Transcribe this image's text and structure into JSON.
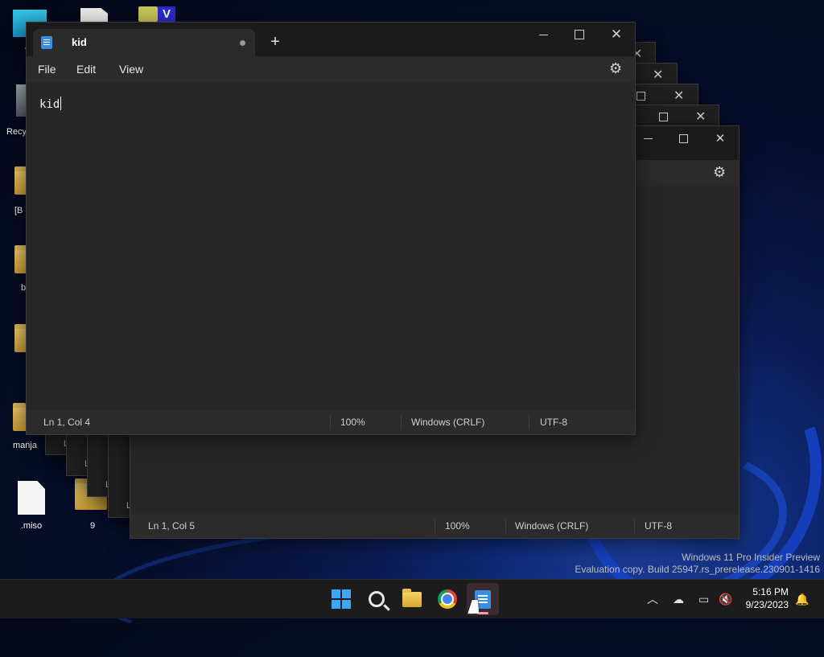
{
  "desktop": {
    "icons": [
      {
        "label": "Th"
      },
      {
        "label": "Recy"
      },
      {
        "label": "[B"
      },
      {
        "label": "b"
      },
      {
        "label": "manja"
      },
      {
        "label": ".miso"
      },
      {
        "label": "9"
      }
    ]
  },
  "main_window": {
    "tab_title": "kid",
    "menu": [
      "File",
      "Edit",
      "View"
    ],
    "content": "kid",
    "status": {
      "position": "Ln 1, Col 4",
      "zoom": "100%",
      "line_ending": "Windows (CRLF)",
      "encoding": "UTF-8"
    }
  },
  "back_window": {
    "status": {
      "position": "Ln 1, Col 5",
      "zoom": "100%",
      "line_ending": "Windows (CRLF)",
      "encoding": "UTF-8"
    }
  },
  "stacked_labels": [
    "L",
    "L",
    "L",
    "L"
  ],
  "watermark": {
    "line1": "Windows 11 Pro Insider Preview",
    "line2": "Evaluation copy. Build 25947.rs_prerelease.230901-1416"
  },
  "taskbar": {
    "time": "5:16 PM",
    "date": "9/23/2023",
    "apps": [
      {
        "icon": "windows-start-icon"
      },
      {
        "icon": "search-icon"
      },
      {
        "icon": "file-explorer-icon"
      },
      {
        "icon": "chrome-icon"
      },
      {
        "icon": "notepad-icon",
        "active": true
      }
    ]
  },
  "colors": {
    "accent": "#3aa8ff",
    "window_bg": "#202020",
    "editor_bg": "#272727"
  }
}
